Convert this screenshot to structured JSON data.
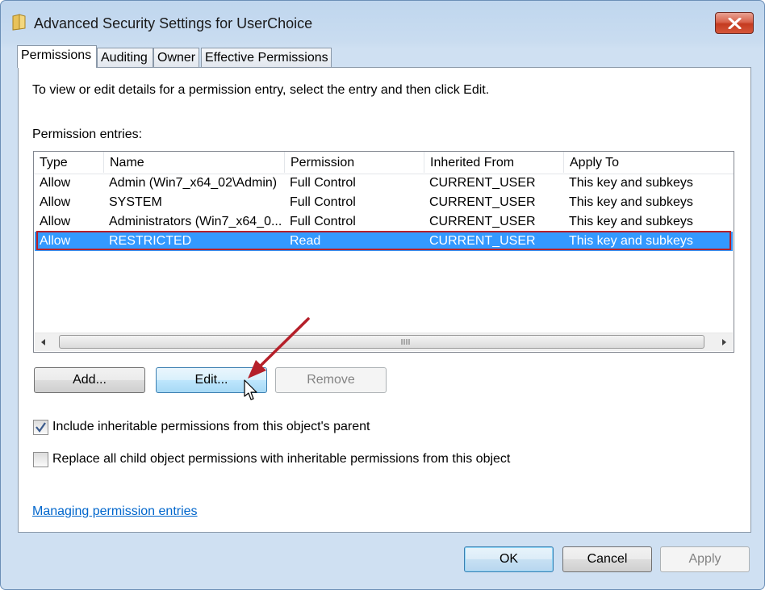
{
  "window": {
    "title": "Advanced Security Settings for UserChoice"
  },
  "tabs": [
    {
      "label": "Permissions"
    },
    {
      "label": "Auditing"
    },
    {
      "label": "Owner"
    },
    {
      "label": "Effective Permissions"
    }
  ],
  "instructions": "To view or edit details for a permission entry, select the entry and then click Edit.",
  "entries_label": "Permission entries:",
  "columns": [
    "Type",
    "Name",
    "Permission",
    "Inherited From",
    "Apply To"
  ],
  "rows": [
    {
      "type": "Allow",
      "name": "Admin (Win7_x64_02\\Admin)",
      "permission": "Full Control",
      "inherited_from": "CURRENT_USER",
      "apply_to": "This key and subkeys"
    },
    {
      "type": "Allow",
      "name": "SYSTEM",
      "permission": "Full Control",
      "inherited_from": "CURRENT_USER",
      "apply_to": "This key and subkeys"
    },
    {
      "type": "Allow",
      "name": "Administrators (Win7_x64_0...",
      "permission": "Full Control",
      "inherited_from": "CURRENT_USER",
      "apply_to": "This key and subkeys"
    },
    {
      "type": "Allow",
      "name": "RESTRICTED",
      "permission": "Read",
      "inherited_from": "CURRENT_USER",
      "apply_to": "This key and subkeys"
    }
  ],
  "selected_row": 3,
  "buttons": {
    "add": "Add...",
    "edit": "Edit...",
    "remove": "Remove"
  },
  "checkboxes": {
    "inherit": {
      "label": "Include inheritable permissions from this object's parent",
      "checked": true
    },
    "replace": {
      "label": "Replace all child object permissions with inheritable permissions from this object",
      "checked": false
    }
  },
  "link": "Managing permission entries",
  "footer": {
    "ok": "OK",
    "cancel": "Cancel",
    "apply": "Apply"
  },
  "colors": {
    "selection": "#3399ff",
    "highlight_outline": "#b5202a",
    "annotation_arrow": "#b5202a",
    "link": "#0066cc"
  }
}
